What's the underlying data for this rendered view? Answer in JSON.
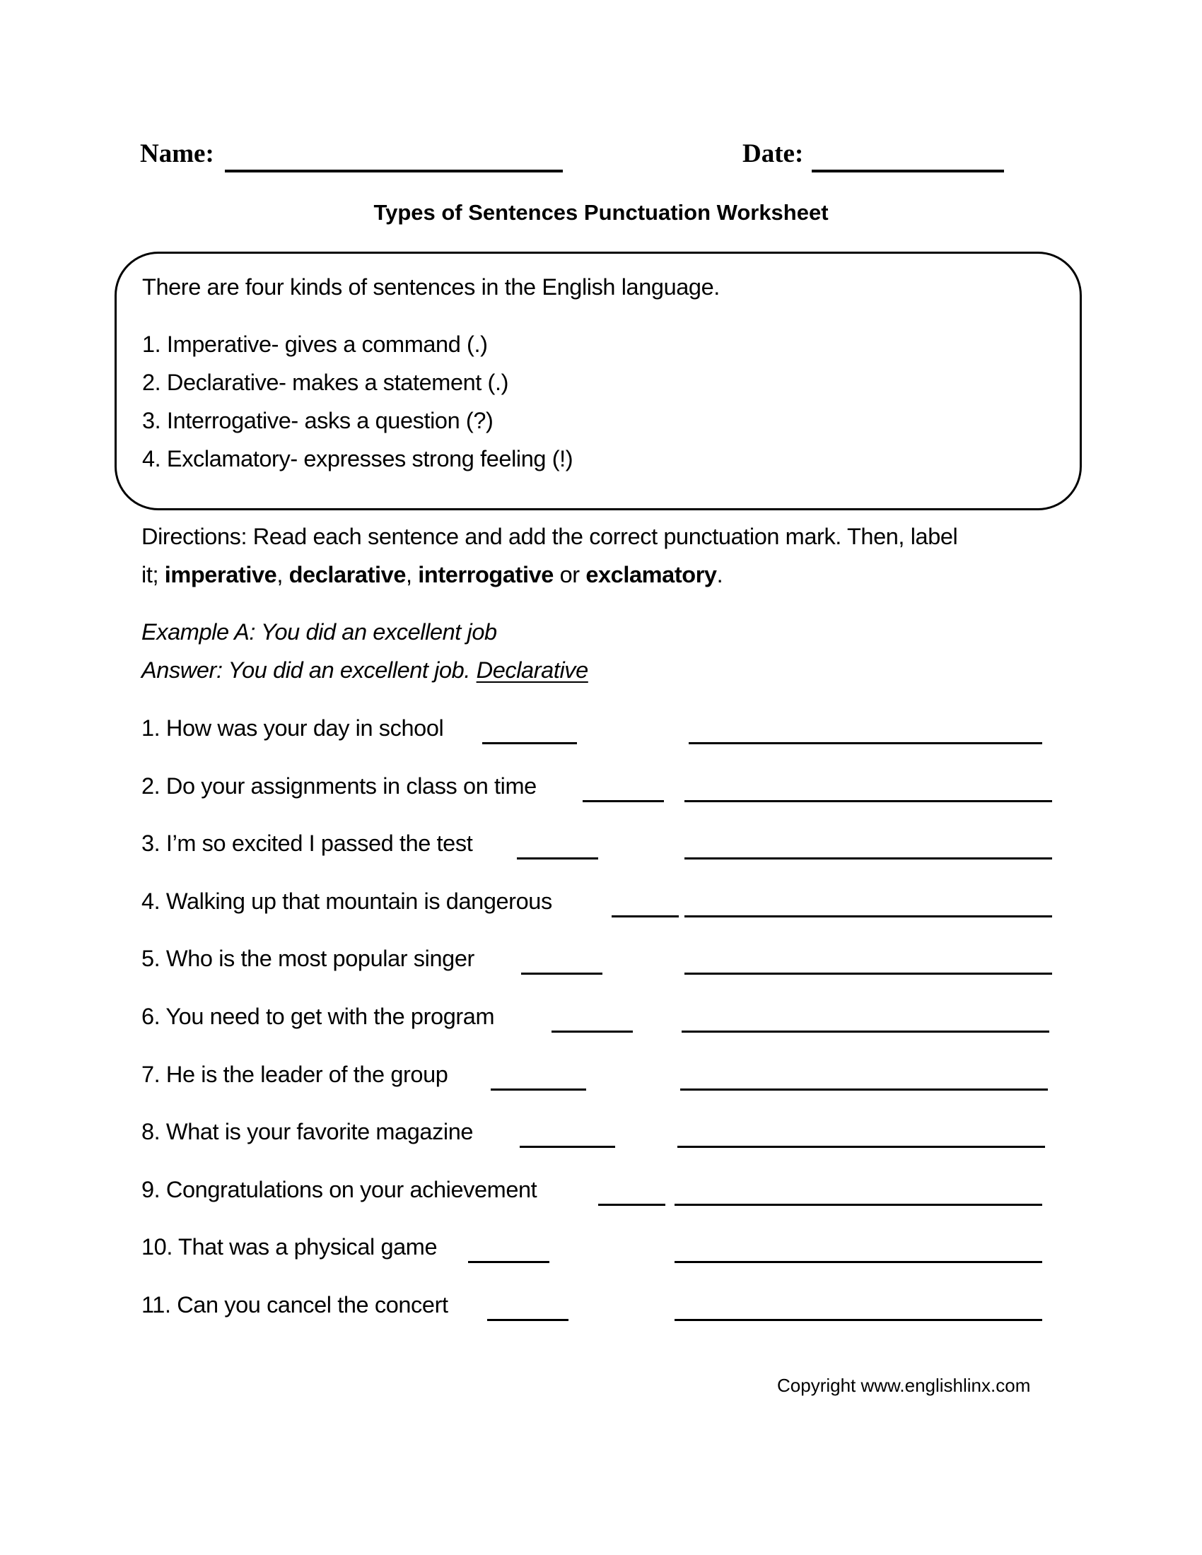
{
  "header": {
    "name_label": "Name:",
    "date_label": "Date:"
  },
  "title": "Types of Sentences Punctuation Worksheet",
  "info_box": {
    "intro": "There are four kinds of sentences in the English language.",
    "types": [
      "1. Imperative- gives a command (.)",
      "2. Declarative- makes a statement (.)",
      "3. Interrogative- asks a question (?)",
      "4. Exclamatory- expresses strong feeling (!)"
    ]
  },
  "directions": {
    "line1": "Directions: Read each sentence and add the correct punctuation mark. Then, label",
    "line2_prefix": "it; ",
    "term1": "imperative",
    "sep1": ", ",
    "term2": "declarative",
    "sep2": ", ",
    "term3": "interrogative",
    "sep3": " or ",
    "term4": "exclamatory",
    "end": "."
  },
  "example": {
    "question": "Example A: You did an excellent job",
    "answer_prefix": "Answer: You did an excellent job. ",
    "answer_label": "Declarative"
  },
  "questions": [
    "1. How was your day in school",
    "2. Do your assignments in class on time",
    "3. I’m so excited I passed the test",
    "4. Walking up that mountain is dangerous",
    "5. Who is the most popular singer",
    "6. You need to get with the program",
    "7. He is the leader of the group",
    "8. What is your favorite magazine",
    "9. Congratulations on your achievement",
    "10. That was a physical game",
    "11. Can you cancel the concert"
  ],
  "footer": {
    "copyright": "Copyright www.englishlinx.com"
  }
}
